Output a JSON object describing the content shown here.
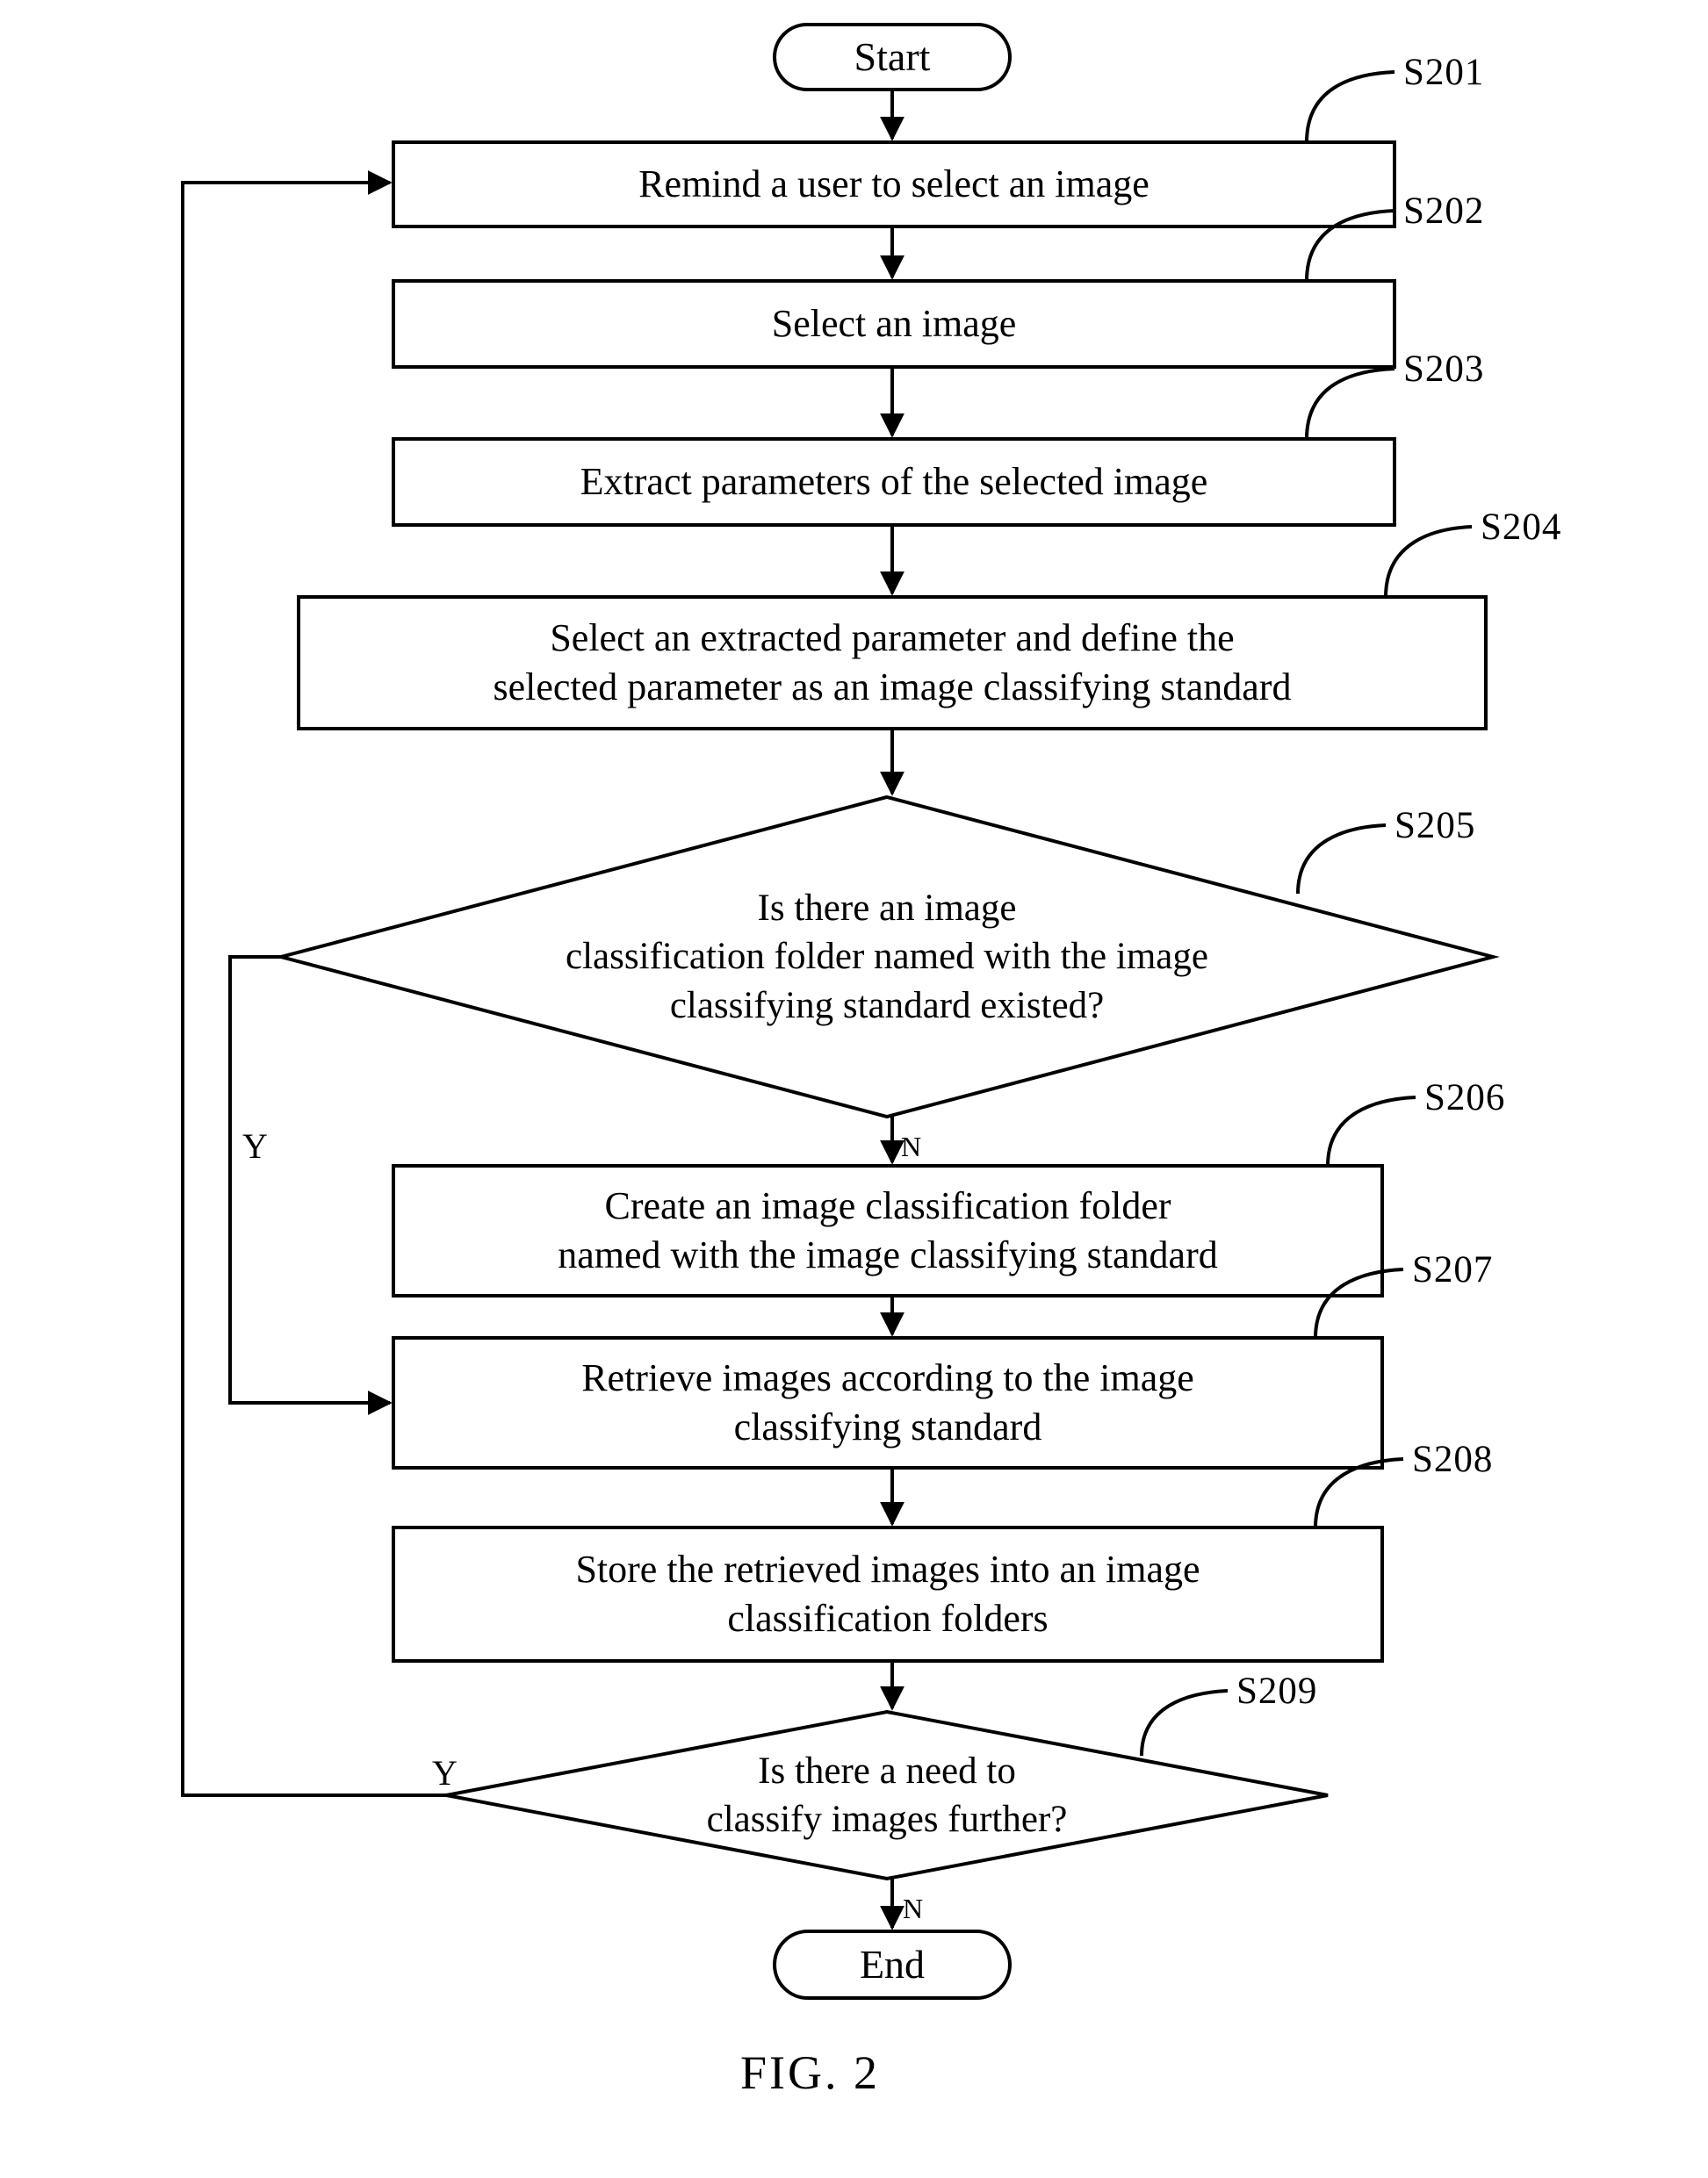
{
  "figure": {
    "caption": "FIG. 2",
    "type": "flowchart"
  },
  "nodes": {
    "start": {
      "shape": "terminal",
      "label": "Start"
    },
    "s201": {
      "shape": "process",
      "step": "S201",
      "lines": [
        "Remind a user to select an image"
      ]
    },
    "s202": {
      "shape": "process",
      "step": "S202",
      "lines": [
        "Select an image"
      ]
    },
    "s203": {
      "shape": "process",
      "step": "S203",
      "lines": [
        "Extract parameters of the selected image"
      ]
    },
    "s204": {
      "shape": "process",
      "step": "S204",
      "lines": [
        "Select an extracted parameter and define the",
        "selected parameter as an image classifying standard"
      ]
    },
    "s205": {
      "shape": "decision",
      "step": "S205",
      "lines": [
        "Is there an image",
        "classification folder named with the image",
        "classifying  standard existed?"
      ],
      "yes_label": "Y",
      "no_label": "N"
    },
    "s206": {
      "shape": "process",
      "step": "S206",
      "lines": [
        "Create an image classification  folder",
        "named with the image classifying  standard"
      ]
    },
    "s207": {
      "shape": "process",
      "step": "S207",
      "lines": [
        "Retrieve images according to the image",
        "classifying standard"
      ]
    },
    "s208": {
      "shape": "process",
      "step": "S208",
      "lines": [
        "Store the retrieved images into an image",
        "classification folders"
      ]
    },
    "s209": {
      "shape": "decision",
      "step": "S209",
      "lines": [
        "Is there a need to",
        "classify images further?"
      ],
      "yes_label": "Y",
      "no_label": "N"
    },
    "end": {
      "shape": "terminal",
      "label": "End"
    }
  },
  "edges": [
    {
      "from": "start",
      "to": "s201",
      "label": ""
    },
    {
      "from": "s201",
      "to": "s202",
      "label": ""
    },
    {
      "from": "s202",
      "to": "s203",
      "label": ""
    },
    {
      "from": "s203",
      "to": "s204",
      "label": ""
    },
    {
      "from": "s204",
      "to": "s205",
      "label": ""
    },
    {
      "from": "s205",
      "to": "s206",
      "label": "N"
    },
    {
      "from": "s205",
      "to": "s207",
      "label": "Y"
    },
    {
      "from": "s206",
      "to": "s207",
      "label": ""
    },
    {
      "from": "s207",
      "to": "s208",
      "label": ""
    },
    {
      "from": "s208",
      "to": "s209",
      "label": ""
    },
    {
      "from": "s209",
      "to": "s201",
      "label": "Y"
    },
    {
      "from": "s209",
      "to": "end",
      "label": "N"
    }
  ],
  "colors": {
    "stroke": "#000000",
    "fill": "#ffffff",
    "text": "#000000"
  }
}
